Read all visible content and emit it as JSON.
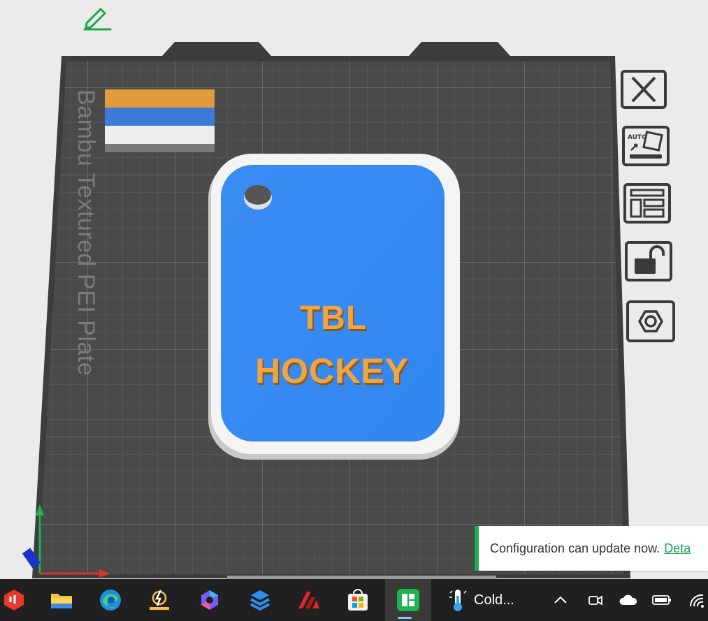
{
  "viewport": {
    "plate_label": "Bambu Textured PEI Plate",
    "model_text_line1": "TBL",
    "model_text_line2": "HOCKEY",
    "colors": {
      "plate": "#4a4a4a",
      "model_body": "#3a8cf2",
      "model_border": "#f4f4f4",
      "model_text": "#f0a444",
      "swatch_orange": "#e39a3b",
      "swatch_blue": "#3a7dd9",
      "swatch_white": "#eeeeee"
    }
  },
  "toolbar": {
    "icons": [
      "close-icon",
      "auto-orient-icon",
      "arrange-icon",
      "lock-icon",
      "settings-hex-icon"
    ]
  },
  "notification": {
    "message": "Configuration can update now.",
    "link": "Deta"
  },
  "taskbar": {
    "apps": [
      "bambu-studio-icon",
      "file-explorer-icon",
      "edge-icon",
      "lightning-icon",
      "copilot-icon",
      "layers-app-icon",
      "autodesk-icon",
      "microsoft-store-icon",
      "active-app-icon"
    ],
    "weather_text": "Cold...",
    "tray": [
      "chevron-up-icon",
      "camera-icon",
      "onedrive-icon",
      "battery-icon",
      "wifi-icon"
    ]
  }
}
